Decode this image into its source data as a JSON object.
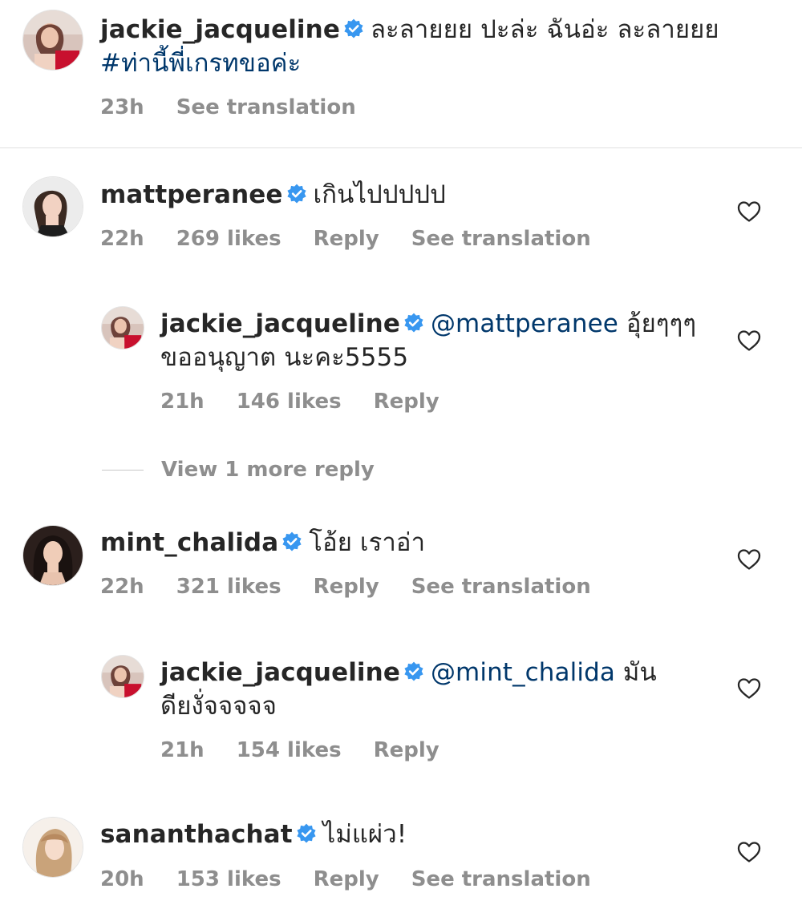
{
  "caption": {
    "username": "jackie_jacqueline",
    "text": "ละลายยย ปะล่ะ  ฉันอ่ะ ละลายยย ",
    "hashtag": "#ท่านี้พี่เกรทขอค่ะ",
    "time": "23h",
    "see_translation": "See translation"
  },
  "comments": [
    {
      "username": "mattperanee",
      "text": "เกินไปปปปป",
      "time": "22h",
      "likes": "269 likes",
      "reply": "Reply",
      "see_translation": "See translation",
      "replies": [
        {
          "username": "jackie_jacqueline",
          "mention": "@mattperanee",
          "text": " อุ้ยๆๆๆ ขออนุญาต นะคะ5555",
          "time": "21h",
          "likes": "146 likes",
          "reply": "Reply"
        }
      ],
      "view_more": "View 1 more reply"
    },
    {
      "username": "mint_chalida",
      "text": "โอ้ย เราอ่า",
      "time": "22h",
      "likes": "321 likes",
      "reply": "Reply",
      "see_translation": "See translation",
      "replies": [
        {
          "username": "jackie_jacqueline",
          "mention": "@mint_chalida",
          "text": "  มันดียงั่จจจจจ",
          "time": "21h",
          "likes": "154 likes",
          "reply": "Reply"
        }
      ]
    },
    {
      "username": "sananthachat",
      "text": "ไม่แผ่ว!",
      "time": "20h",
      "likes": "153 likes",
      "reply": "Reply",
      "see_translation": "See translation"
    }
  ],
  "colors": {
    "verified_badge": "#3897f0",
    "link": "#00376b",
    "meta": "#8e8e8e",
    "text": "#262626"
  },
  "icons": [
    "verified-badge-icon",
    "heart-icon"
  ]
}
